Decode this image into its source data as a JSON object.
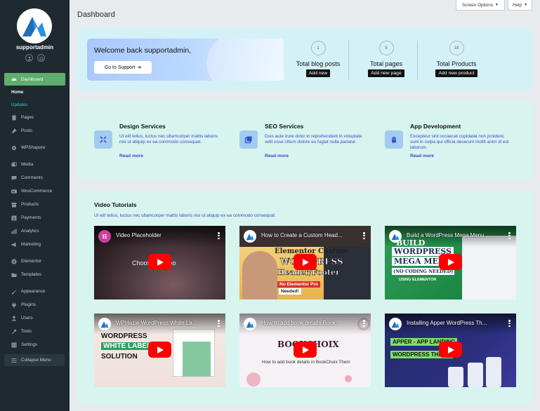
{
  "sidebar": {
    "username": "supportadmin",
    "menu": {
      "dashboard": "Dashboard",
      "home": "Home",
      "updates": "Updates",
      "pages": "Pages",
      "posts": "Posts",
      "wpshapere": "WPShapere",
      "media": "Media",
      "comments": "Comments",
      "woocommerce": "WooCommerce",
      "products": "Products",
      "payments": "Payments",
      "analytics": "Analytics",
      "marketing": "Marketing",
      "elementor": "Elementor",
      "templates": "Templates",
      "appearance": "Appearance",
      "plugins": "Plugins",
      "users": "Users",
      "tools": "Tools",
      "settings": "Settings"
    },
    "collapse_label": "Collapse Menu"
  },
  "topbar": {
    "screen_options": "Screen Options",
    "help": "Help"
  },
  "page": {
    "title": "Dashboard"
  },
  "welcome": {
    "greeting": "Welcome back supportadmin,",
    "go_button": "Go to Support",
    "stats": [
      {
        "count": "1",
        "label": "Total blog posts",
        "button": "Add new"
      },
      {
        "count": "5",
        "label": "Total pages",
        "button": "Add new page"
      },
      {
        "count": "18",
        "label": "Total Products",
        "button": "Add new product"
      }
    ]
  },
  "services": [
    {
      "title": "Design Services",
      "desc": "Ut elit tellus, luctus nec ullamcorper mattis  laboris nisi ut aliquip ex ea commodo consequat.",
      "more": "Read more",
      "icon": "design-tools-icon"
    },
    {
      "title": "SEO Services",
      "desc": "Duis aute irure dolor in reprehenderit in voluptate velit esse cillum dolore eu fugiat nulla pariatur.",
      "more": "Read more",
      "icon": "copy-window-icon"
    },
    {
      "title": "App Development",
      "desc": "Excepteur sint occaecat cupidatat non proident, sunt in culpa qui officia deserunt mollit anim id est laborum.",
      "more": "Read more",
      "icon": "android-icon"
    }
  ],
  "videos": {
    "title": "Video Tutorials",
    "desc": "Ut elit tellus, luctus nec ullamcorper mattis  laboris nisi ut aliquip ex ea commodo consequat.",
    "items": [
      {
        "title": "Video Placeholder",
        "overlay": "Choose a video"
      },
      {
        "title": "How to Create a Custom Head...",
        "line1": "Elementor Custom",
        "line2": "WORDPRESS",
        "line3": "Header/Footer",
        "badge": "No Elementor Pro",
        "badge2": "Needed!"
      },
      {
        "title": "Build a WordPress Mega Menu...",
        "line1": "BUILD",
        "line2": "WORDPRESS",
        "line3": "MEGA MENU",
        "line4": "(NO CODING NEEDED)",
        "line5": "USING ELEMENTOR"
      },
      {
        "title": "WPHazie WordPress White La...",
        "line1": "WORDPRESS",
        "line2": "WHITE LABEL",
        "line3": "SOLUTION"
      },
      {
        "title": "How to add book details Book...",
        "line1": "BOOKCHOIX",
        "line2": "How to add book details in BookChoix Them"
      },
      {
        "title": "Installing Apper WordPress Th...",
        "line1": "APPER - APP LANDING",
        "line2": "WORDPRESS THEME"
      }
    ]
  },
  "colors": {
    "sidebar_bg": "#1f2a30",
    "active_green": "#5fae6d",
    "link_blue": "#3a4ad0",
    "youtube_red": "#ff0000"
  }
}
